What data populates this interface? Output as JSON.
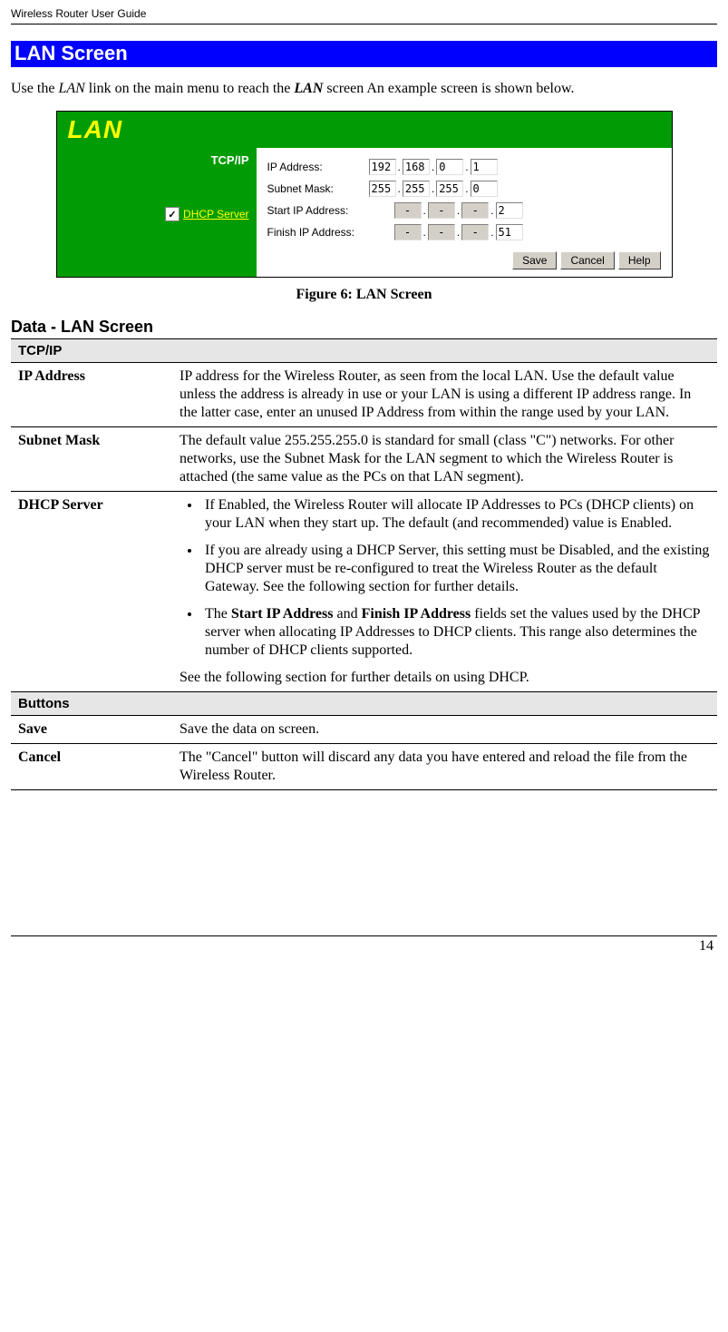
{
  "header": {
    "title": "Wireless Router User Guide"
  },
  "section": {
    "title": "LAN Screen"
  },
  "intro": {
    "pre": "Use the ",
    "lan1": "LAN",
    "mid1": " link on the main menu to reach the ",
    "lan2": "LAN",
    "post": " screen An example screen is shown below."
  },
  "screenshot": {
    "title": "LAN",
    "sidebar_label": "TCP/IP",
    "check_label": "DHCP Server",
    "rows": {
      "ip_label": "IP Address:",
      "ip": [
        "192",
        "168",
        "0",
        "1"
      ],
      "mask_label": "Subnet Mask:",
      "mask": [
        "255",
        "255",
        "255",
        "0"
      ],
      "start_label": "Start IP Address:",
      "start": [
        "-",
        "-",
        "-",
        "2"
      ],
      "finish_label": "Finish IP Address:",
      "finish": [
        "-",
        "-",
        "-",
        "51"
      ]
    },
    "buttons": {
      "save": "Save",
      "cancel": "Cancel",
      "help": "Help"
    }
  },
  "figure_caption": "Figure 6: LAN Screen",
  "subsection": "Data - LAN Screen",
  "table": {
    "group1": "TCP/IP",
    "ip_label": "IP Address",
    "ip_desc": "IP address for the Wireless Router, as seen from the local LAN. Use the default value unless the address is already in use or your LAN is using a different IP address range. In the latter case, enter an unused IP Address from within the range used by your LAN.",
    "mask_label": "Subnet Mask",
    "mask_desc": "The default value 255.255.255.0 is standard for small (class \"C\") networks. For other networks, use the Subnet Mask for the LAN segment to which the Wireless Router is attached (the same value as the PCs on that LAN segment).",
    "dhcp_label": "DHCP Server",
    "dhcp_b1": "If Enabled, the Wireless Router will allocate IP Addresses to PCs (DHCP clients) on your LAN when they start up. The default (and recommended) value is Enabled.",
    "dhcp_b2": "If you are already using a DHCP Server, this setting must be Disabled, and the existing DHCP server must be re-configured to treat the Wireless Router as the default Gateway. See the following section for further details.",
    "dhcp_b3_pre": "The ",
    "dhcp_b3_s1": "Start IP Address",
    "dhcp_b3_mid": " and ",
    "dhcp_b3_s2": "Finish IP Address",
    "dhcp_b3_post": " fields set the values used by the DHCP server when allocating IP Addresses to DHCP clients. This range also determines the number of DHCP clients supported.",
    "dhcp_foot": "See the following section for further details on using DHCP.",
    "group2": "Buttons",
    "save_label": "Save",
    "save_desc": "Save the data on screen.",
    "cancel_label": "Cancel",
    "cancel_desc": "The \"Cancel\" button will discard any data you have entered and reload the file from the Wireless Router."
  },
  "page_number": "14"
}
